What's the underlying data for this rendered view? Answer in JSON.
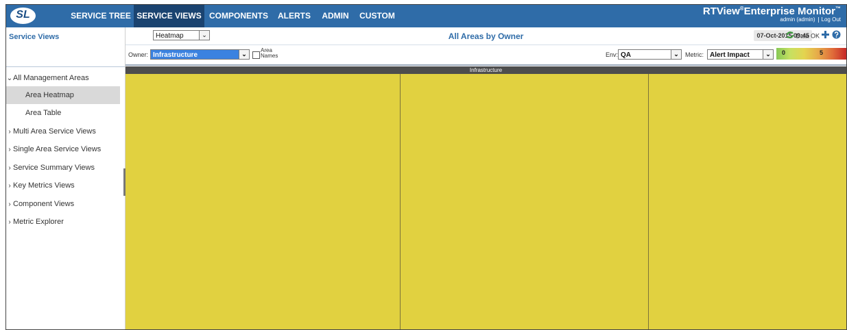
{
  "app": {
    "logo_text": "SL",
    "brand_title": "RTView",
    "brand_reg": "®",
    "brand_title2": "Enterprise Monitor",
    "brand_tm": "™",
    "user": "admin (admin)",
    "logout": "Log Out"
  },
  "nav": {
    "service_tree": "SERVICE TREE",
    "service_views": "SERVICE VIEWS",
    "components": "COMPONENTS",
    "alerts": "ALERTS",
    "admin": "ADMIN",
    "custom": "CUSTOM"
  },
  "sidebar": {
    "title": "Service Views",
    "items": [
      {
        "label": "All Management Areas",
        "chevron": "⌄"
      },
      {
        "label": "Area Heatmap"
      },
      {
        "label": "Area Table"
      },
      {
        "label": "Multi Area Service Views",
        "chevron": "›"
      },
      {
        "label": "Single Area Service Views",
        "chevron": "›"
      },
      {
        "label": "Service Summary Views",
        "chevron": "›"
      },
      {
        "label": "Key Metrics Views",
        "chevron": "›"
      },
      {
        "label": "Component Views",
        "chevron": "›"
      },
      {
        "label": "Metric Explorer",
        "chevron": "›"
      }
    ]
  },
  "header": {
    "view_select": "Heatmap",
    "title": "All Areas by Owner",
    "datetime": "07-Oct-2015 09:45",
    "data_status": "Data OK"
  },
  "filters": {
    "owner_label": "Owner:",
    "owner_value": "Infrastructure",
    "area_names_label1": "Area",
    "area_names_label2": "Names",
    "env_label": "Env:",
    "env_value": "QA",
    "metric_label": "Metric:",
    "metric_value": "Alert Impact",
    "scale_min": "0",
    "scale_mid": "5"
  },
  "heatmap": {
    "group_label": "Infrastructure",
    "cell_color": "#e1d140"
  },
  "colors": {
    "nav_bg": "#2f6ca8",
    "nav_active": "#1a4370",
    "accent": "#2f6ca8"
  }
}
